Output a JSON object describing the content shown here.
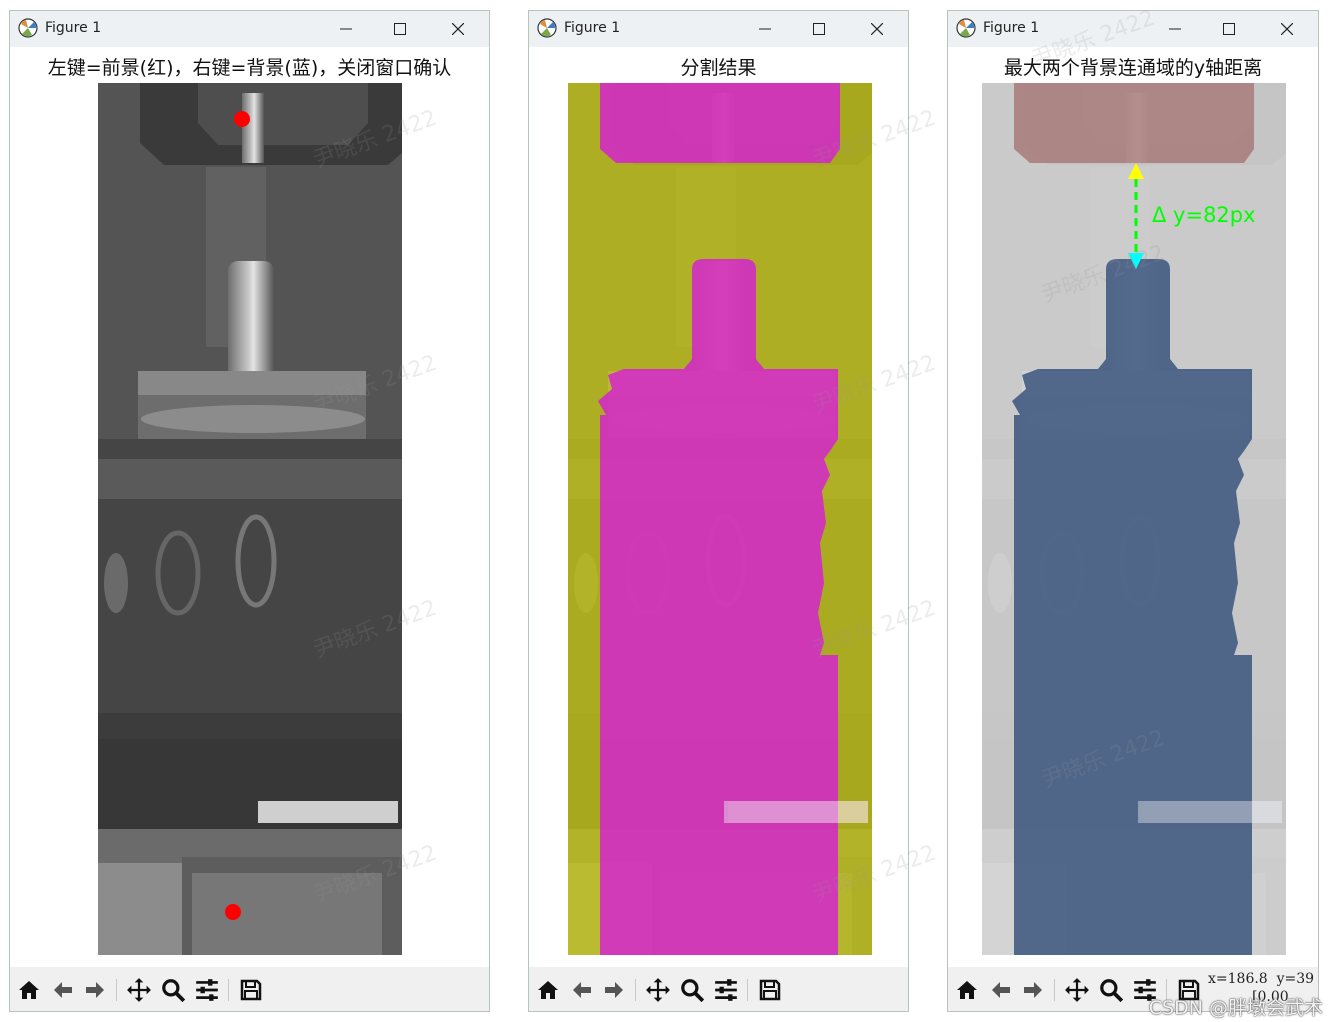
{
  "windows": [
    {
      "title": "Figure 1",
      "figure_title": "左键=前景(红)，右键=背景(蓝)，关闭窗口确认",
      "coords": null
    },
    {
      "title": "Figure 1",
      "figure_title": "分割结果",
      "coords": null
    },
    {
      "title": "Figure 1",
      "figure_title": "最大两个背景连通域的y轴距离",
      "annotation": "Δ y=82px",
      "coords": {
        "line1": "x=186.8  y=39",
        "line2": "[0.00"
      }
    }
  ],
  "toolbar": {
    "icons": [
      "home-icon",
      "back-icon",
      "forward-icon",
      "pan-icon",
      "zoom-icon",
      "configure-icon",
      "save-icon"
    ]
  },
  "watermark": {
    "text": "尹晓乐 2422",
    "csdn": "CSDN @胖墩会武术"
  },
  "colors": {
    "foreground_mask": "#d51fd5",
    "background_mask": "#c8c817",
    "lower_region": "#3b557e",
    "upper_region": "#a26c6c",
    "arrow": "#00ff00",
    "arrow_head_up": "#ffff00",
    "arrow_head_down": "#00ffff",
    "click_point": "#ff0000"
  }
}
